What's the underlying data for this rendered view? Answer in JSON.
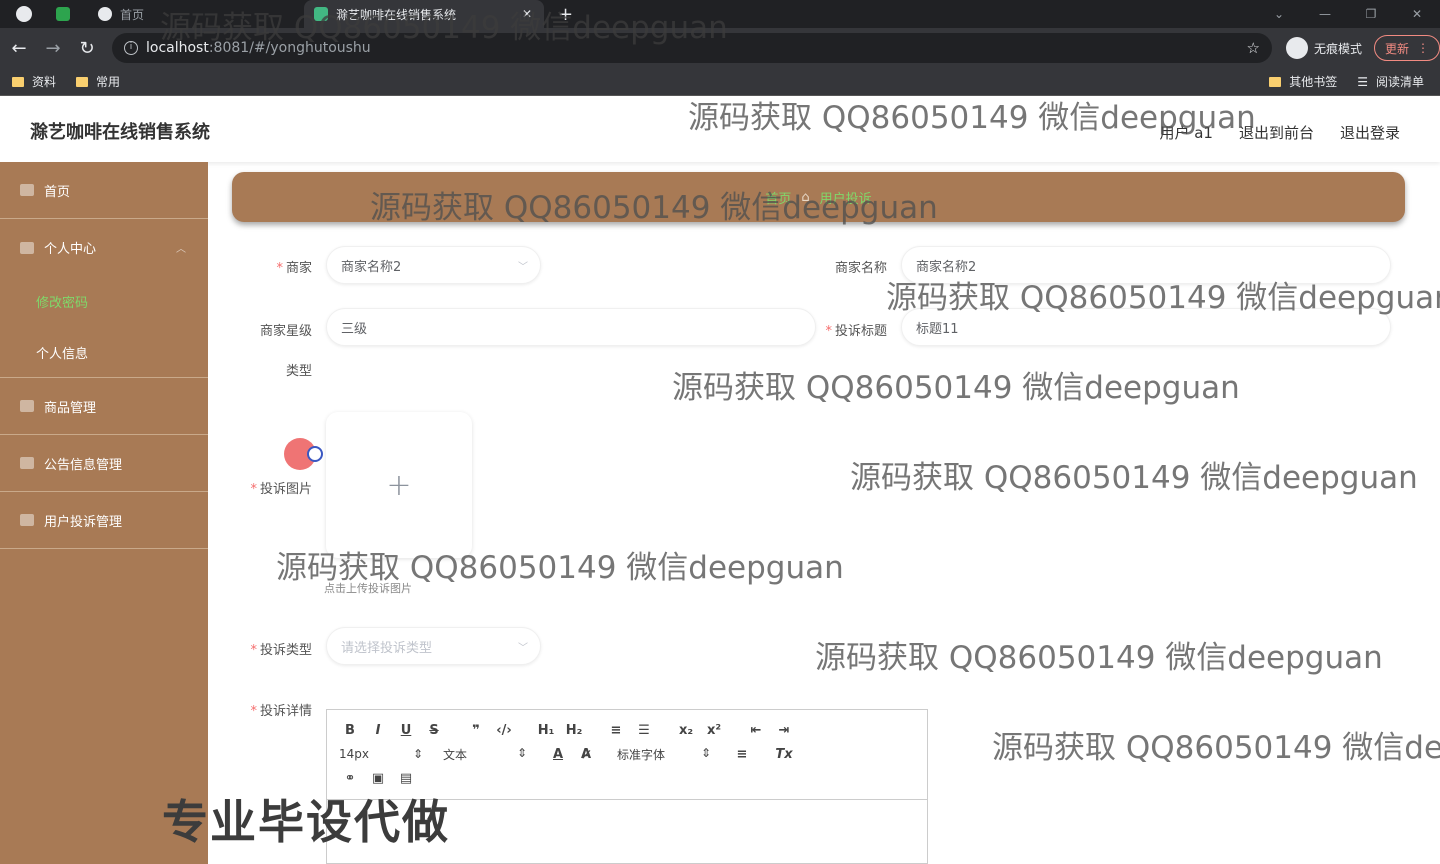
{
  "browser": {
    "tabs": [
      {
        "label": "首页",
        "active": false
      },
      {
        "label": "滁艺咖啡在线销售系统",
        "active": true
      }
    ],
    "url_host": "localhost",
    "url_path": ":8081/#/yonghutoushu",
    "incognito_label": "无痕模式",
    "update_label": "更新",
    "bookmarks": [
      "资料",
      "常用"
    ],
    "bookmarks_right": [
      "其他书签",
      "阅读清单"
    ],
    "window_controls": [
      "⌄",
      "—",
      "❐",
      "✕"
    ]
  },
  "header": {
    "title": "滁艺咖啡在线销售系统",
    "user": "用户 a1",
    "back_front": "退出到前台",
    "logout": "退出登录"
  },
  "sidebar": {
    "items": [
      {
        "label": "首页"
      },
      {
        "label": "个人中心"
      },
      {
        "label": "商品管理"
      },
      {
        "label": "公告信息管理"
      },
      {
        "label": "用户投诉管理"
      }
    ],
    "sub_items": [
      {
        "label": "修改密码",
        "active": true
      },
      {
        "label": "个人信息",
        "active": false
      }
    ]
  },
  "breadcrumb": {
    "home": "首页",
    "current": "用户投诉"
  },
  "form": {
    "merchant_label": "商家",
    "merchant_value": "商家名称2",
    "merchant_name_label": "商家名称",
    "merchant_name_value": "商家名称2",
    "merchant_level_label": "商家星级",
    "merchant_level_value": "三级",
    "complaint_title_label": "投诉标题",
    "complaint_title_value": "标题11",
    "type_label": "类型",
    "image_label": "投诉图片",
    "upload_tip": "点击上传投诉图片",
    "complaint_type_label": "投诉类型",
    "complaint_type_placeholder": "请选择投诉类型",
    "detail_label": "投诉详情"
  },
  "editor": {
    "font_size": "14px",
    "paragraph": "文本",
    "font_family": "标准字体"
  },
  "watermarks": {
    "text": "源码获取 QQ86050149 微信deepguan",
    "text_cut": "源码获取 QQ86050149 微信deep",
    "big": "专业毕设代做"
  }
}
